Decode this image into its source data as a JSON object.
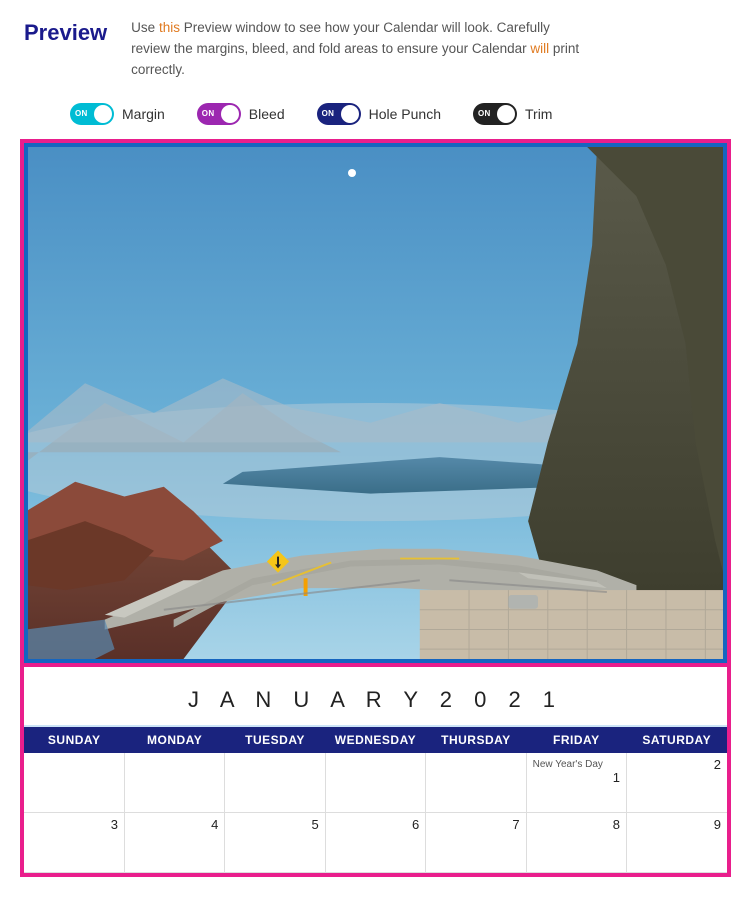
{
  "header": {
    "title": "Preview",
    "description": {
      "before_link": "Use ",
      "link_this": "this",
      "middle": " Preview window to see how your Calendar will look. Carefully review the margins, bleed, and fold areas to ensure your Calendar ",
      "link_will": "will",
      "after": " print correctly."
    }
  },
  "toggles": [
    {
      "id": "margin",
      "label": "Margin",
      "state": "ON",
      "color": "cyan"
    },
    {
      "id": "bleed",
      "label": "Bleed",
      "state": "ON",
      "color": "purple"
    },
    {
      "id": "hole-punch",
      "label": "Hole Punch",
      "state": "ON",
      "color": "dark-blue"
    },
    {
      "id": "trim",
      "label": "Trim",
      "state": "ON",
      "color": "dark"
    }
  ],
  "calendar": {
    "month_title": "J A N U A R Y   2 0 2 1",
    "days_of_week": [
      "SUNDAY",
      "MONDAY",
      "TUESDAY",
      "WEDNESDAY",
      "THURSDAY",
      "FRIDAY",
      "SATURDAY"
    ],
    "weeks": [
      [
        {
          "day": "",
          "events": []
        },
        {
          "day": "",
          "events": []
        },
        {
          "day": "",
          "events": []
        },
        {
          "day": "",
          "events": []
        },
        {
          "day": "",
          "events": []
        },
        {
          "day": "1",
          "events": [
            "New Year's Day"
          ]
        },
        {
          "day": "2",
          "events": []
        }
      ],
      [
        {
          "day": "3",
          "events": []
        },
        {
          "day": "4",
          "events": []
        },
        {
          "day": "5",
          "events": []
        },
        {
          "day": "6",
          "events": []
        },
        {
          "day": "7",
          "events": []
        },
        {
          "day": "8",
          "events": []
        },
        {
          "day": "9",
          "events": []
        }
      ]
    ]
  }
}
